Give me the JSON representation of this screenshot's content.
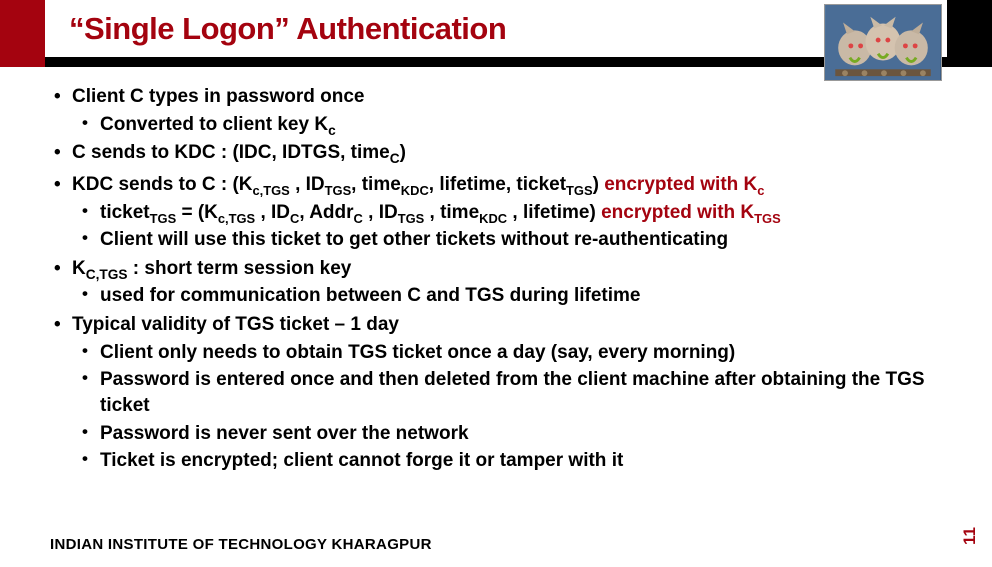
{
  "title": "“Single Logon”  Authentication",
  "bullets": {
    "b1": "Client C types in password once",
    "b1_1_pre": "Converted to client key K",
    "b1_1_sub": "c",
    "b2_pre": "C sends to KDC : (IDC, IDTGS, time",
    "b2_sub": "C",
    "b2_post": ")",
    "b3_pre": "KDC sends to C : (K",
    "b3_s1": "c,TGS",
    "b3_mid1": " , ID",
    "b3_s2": "TGS",
    "b3_mid2": ", time",
    "b3_s3": "KDC",
    "b3_mid3": ", lifetime, ticket",
    "b3_s4": "TGS",
    "b3_mid4": ") ",
    "b3_red1": "encrypted with K",
    "b3_reds1": "c",
    "b3_1_pre": "ticket",
    "b3_1_s1": "TGS",
    "b3_1_mid1": " = (K",
    "b3_1_s2": "c,TGS",
    "b3_1_mid2": " , ID",
    "b3_1_s3": "C",
    "b3_1_mid3": ", Addr",
    "b3_1_s4": "C",
    "b3_1_mid4": " , ID",
    "b3_1_s5": "TGS",
    "b3_1_mid5": " , time",
    "b3_1_s6": "KDC",
    "b3_1_mid6": " , lifetime) ",
    "b3_1_red": "encrypted with K",
    "b3_1_reds": "TGS",
    "b3_2": "Client will use this ticket to get other tickets without re-authenticating",
    "b4_pre": "K",
    "b4_s1": "C,TGS",
    "b4_post": " : short term session key",
    "b4_1": "used for communication between C and TGS during lifetime",
    "b5": "Typical validity of TGS ticket – 1 day",
    "b5_1": "Client only needs to obtain TGS ticket once a day (say, every morning)",
    "b5_2": "Password is entered once and then deleted from the client machine after obtaining the TGS ticket",
    "b5_3": "Password is never sent over the network",
    "b5_4": "Ticket is encrypted; client cannot forge it or tamper with it"
  },
  "footer": "INDIAN INSTITUTE OF TECHNOLOGY KHARAGPUR",
  "page": "11"
}
